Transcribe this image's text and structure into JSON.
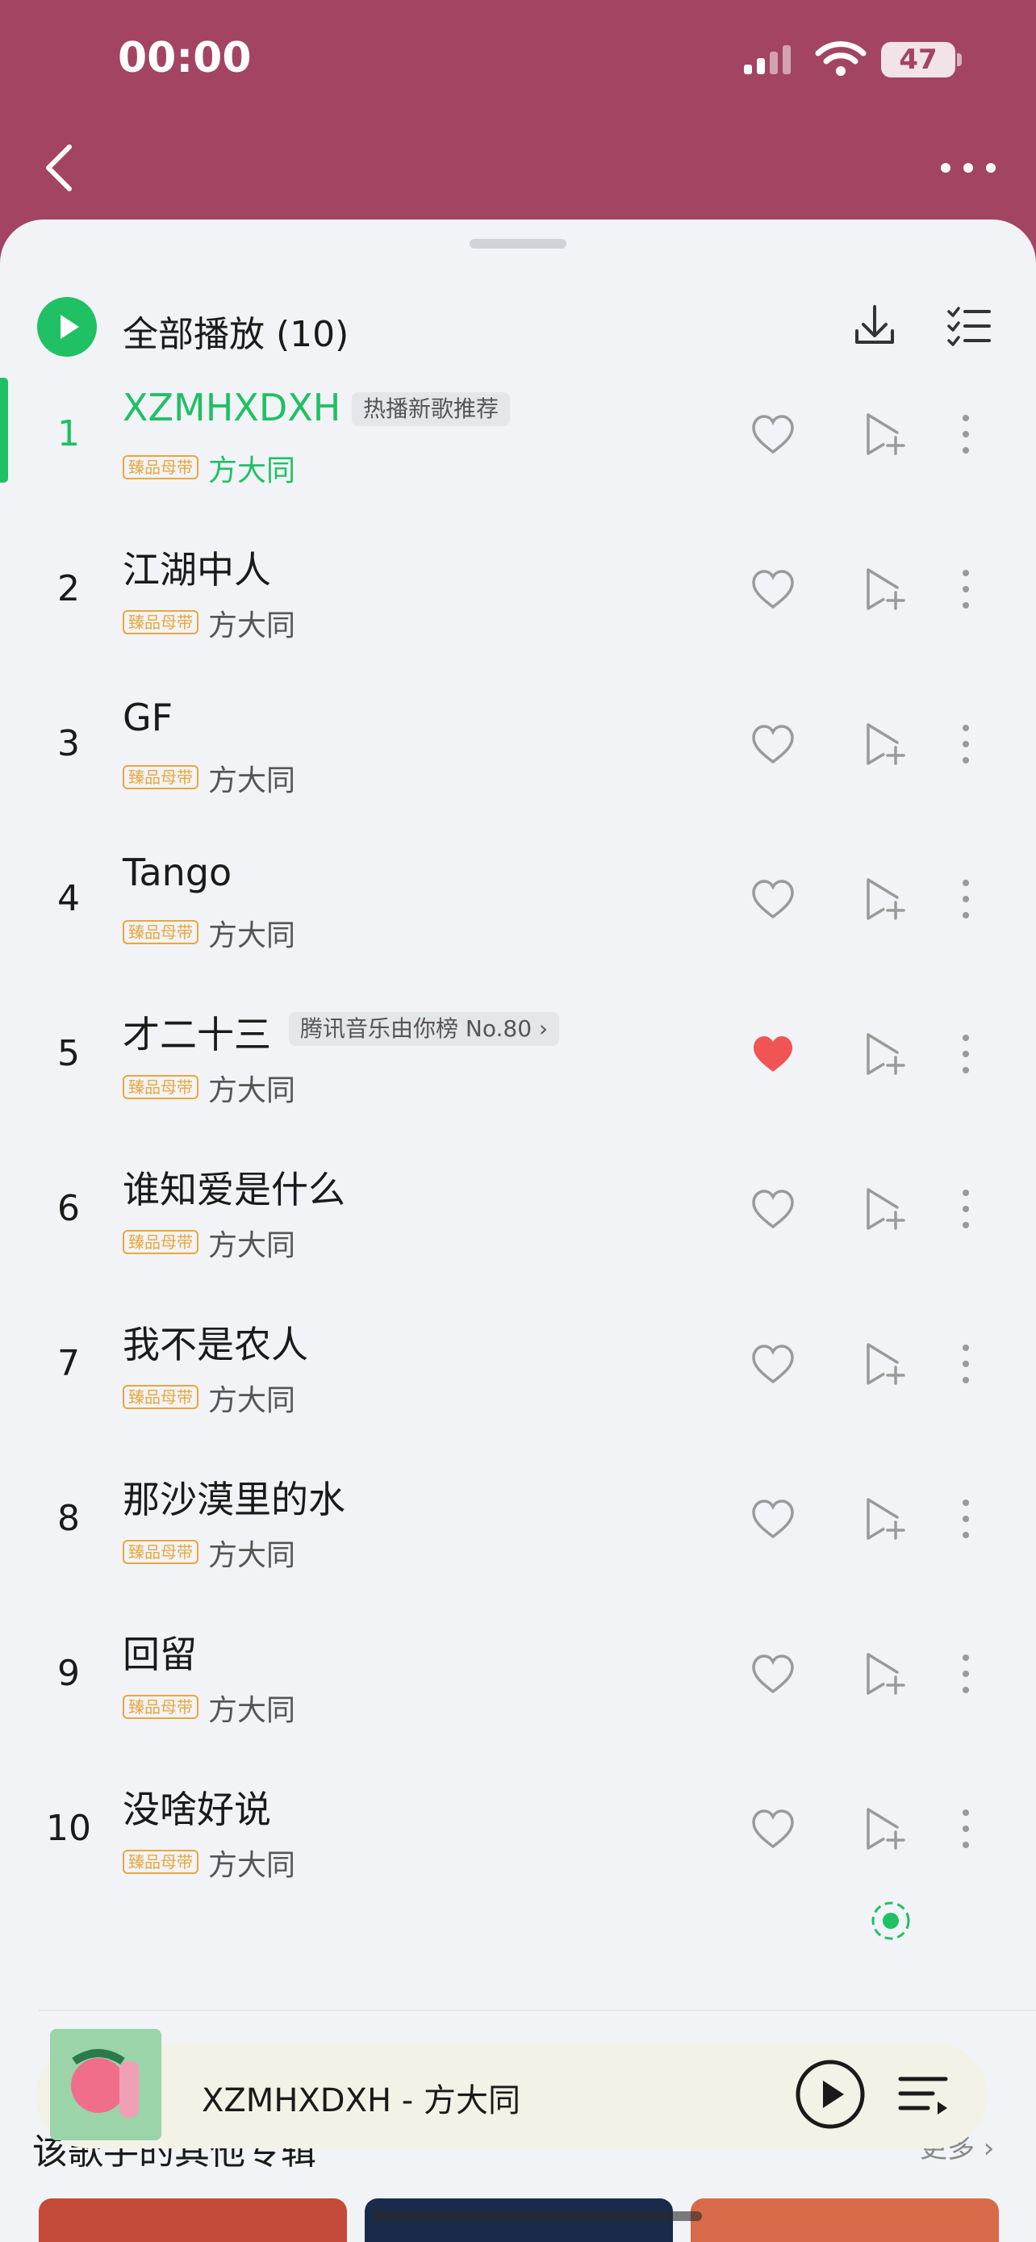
{
  "status": {
    "time": "00:00",
    "battery": "47"
  },
  "header": {
    "play_all": "全部播放",
    "count": "(10)"
  },
  "songs": [
    {
      "n": "1",
      "title": "XZMHXDXH",
      "tag": "热播新歌推荐",
      "artist": "方大同",
      "quality": "臻品母带",
      "liked": false,
      "active": true
    },
    {
      "n": "2",
      "title": "江湖中人",
      "tag": "",
      "artist": "方大同",
      "quality": "臻品母带",
      "liked": false
    },
    {
      "n": "3",
      "title": "GF",
      "tag": "",
      "artist": "方大同",
      "quality": "臻品母带",
      "liked": false
    },
    {
      "n": "4",
      "title": "Tango",
      "tag": "",
      "artist": "方大同",
      "quality": "臻品母带",
      "liked": false
    },
    {
      "n": "5",
      "title": "才二十三",
      "tag": "腾讯音乐由你榜 No.80 ›",
      "artist": "方大同",
      "quality": "臻品母带",
      "liked": true
    },
    {
      "n": "6",
      "title": "谁知爱是什么",
      "tag": "",
      "artist": "方大同",
      "quality": "臻品母带",
      "liked": false
    },
    {
      "n": "7",
      "title": "我不是农人",
      "tag": "",
      "artist": "方大同",
      "quality": "臻品母带",
      "liked": false
    },
    {
      "n": "8",
      "title": "那沙漠里的水",
      "tag": "",
      "artist": "方大同",
      "quality": "臻品母带",
      "liked": false
    },
    {
      "n": "9",
      "title": "回留",
      "tag": "",
      "artist": "方大同",
      "quality": "臻品母带",
      "liked": false
    },
    {
      "n": "10",
      "title": "没啥好说",
      "tag": "",
      "artist": "方大同",
      "quality": "臻品母带",
      "liked": false
    }
  ],
  "mini_player": {
    "title": "XZMHXDXH - 方大同"
  },
  "section": {
    "title": "该歌手的其他专辑",
    "more": "更多 ›"
  },
  "colors": {
    "accent": "#20c065",
    "heart_liked": "#f05454",
    "header_bg": "#a34463"
  }
}
